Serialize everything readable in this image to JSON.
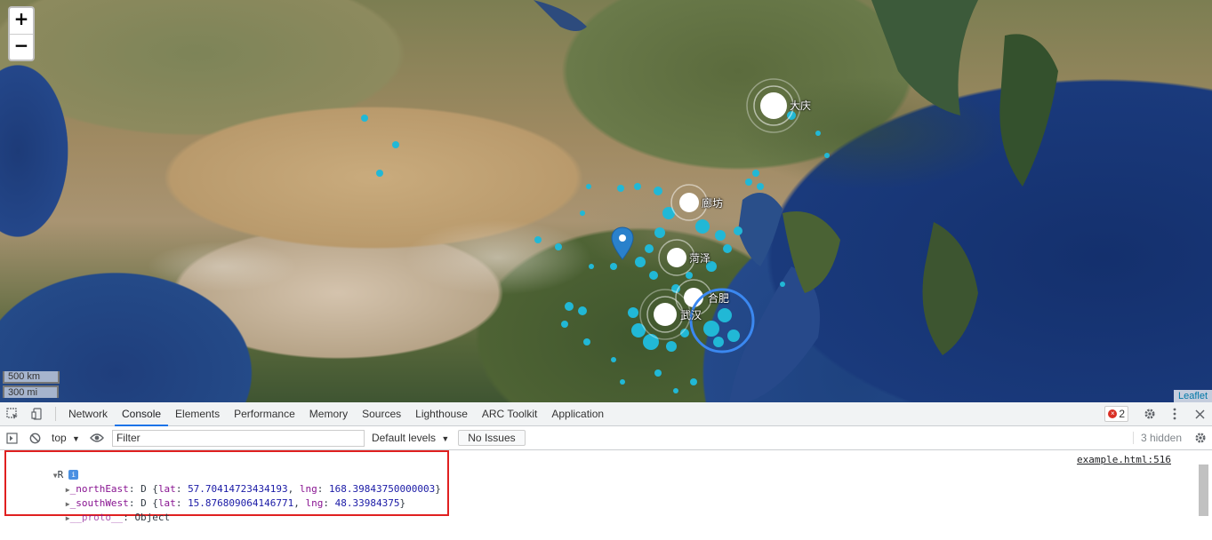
{
  "map": {
    "zoom_in_label": "+",
    "zoom_out_label": "−",
    "scale_km": "500 km",
    "scale_mi": "300 mi",
    "attribution": "Leaflet",
    "cities": [
      {
        "name": "大庆"
      },
      {
        "name": "廊坊"
      },
      {
        "name": "菏泽"
      },
      {
        "name": "合肥"
      },
      {
        "name": "武汉"
      }
    ],
    "accent_color": "#21b8d6",
    "marker_color": "#2a81cb"
  },
  "devtools": {
    "tabs": [
      "Network",
      "Console",
      "Elements",
      "Performance",
      "Memory",
      "Sources",
      "Lighthouse",
      "ARC Toolkit",
      "Application"
    ],
    "active_tab": "Console",
    "error_count": "2",
    "context": "top",
    "filter_placeholder": "Filter",
    "levels": "Default levels",
    "issues": "No Issues",
    "hidden": "3 hidden"
  },
  "console": {
    "object_name": "R",
    "source": "example.html:516",
    "north_east": {
      "key": "_northEast",
      "type": "D",
      "lat": "57.70414723434193",
      "lng": "168.39843750000003"
    },
    "south_west": {
      "key": "_southWest",
      "type": "D",
      "lat": "15.876809064146771",
      "lng": "48.33984375"
    },
    "proto": {
      "key": "__proto__",
      "value": "Object"
    }
  }
}
